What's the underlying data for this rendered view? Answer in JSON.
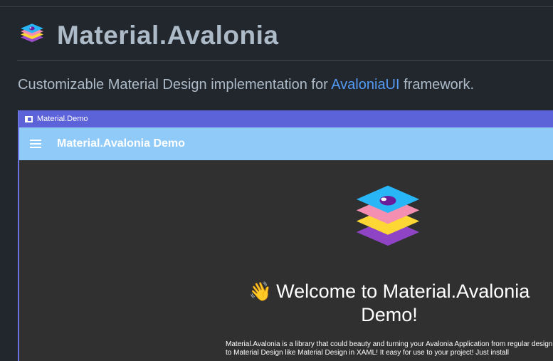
{
  "readme": {
    "title": "Material.Avalonia",
    "description_prefix": "Customizable Material Design implementation for ",
    "description_link": "AvaloniaUI",
    "description_suffix": " framework."
  },
  "demo": {
    "window_title": "Material.Demo",
    "app_bar_title": "Material.Avalonia Demo",
    "welcome_heading": "Welcome to Material.Avalonia Demo!",
    "wave_emoji": "👋",
    "body_text": "Material.Avalonia is a library that could beauty and turning your Avalonia Application from regular design to Material Design like Material Design in XAML! It easy for use to your project! Just install"
  },
  "colors": {
    "page_bg": "#22272e",
    "link": "#539bf5",
    "window_titlebar": "#5c62d8",
    "app_bar": "#90caf9",
    "content_bg": "#303030",
    "logo_layers": [
      "#29b6f6",
      "#f48fb1",
      "#fdd835",
      "#9c4dcc"
    ]
  },
  "icons": {
    "logo": "layered-stack-logo",
    "menu": "hamburger-menu-icon",
    "window": "window-icon"
  }
}
